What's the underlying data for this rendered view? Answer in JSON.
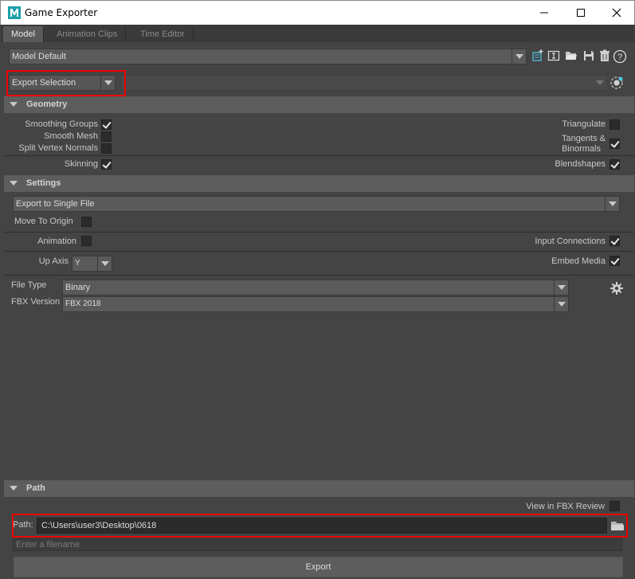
{
  "window": {
    "title": "Game Exporter"
  },
  "tabs": [
    {
      "label": "Model"
    },
    {
      "label": "Animation Clips"
    },
    {
      "label": "Time Editor"
    }
  ],
  "preset": {
    "value": "Model Default"
  },
  "export_mode": {
    "value": "Export Selection"
  },
  "geometry": {
    "header": "Geometry",
    "smoothing_groups": {
      "label": "Smoothing Groups",
      "checked": true
    },
    "smooth_mesh": {
      "label": "Smooth Mesh",
      "checked": false
    },
    "split_vertex_normals": {
      "label": "Split Vertex Normals",
      "checked": false
    },
    "skinning": {
      "label": "Skinning",
      "checked": true
    },
    "triangulate": {
      "label": "Triangulate",
      "checked": false
    },
    "tangents_binormals": {
      "label_line1": "Tangents &",
      "label_line2": "Binormals",
      "checked": true
    },
    "blendshapes": {
      "label": "Blendshapes",
      "checked": true
    }
  },
  "settings": {
    "header": "Settings",
    "file_mode": {
      "value": "Export to Single File"
    },
    "move_to_origin": {
      "label": "Move To Origin",
      "checked": false
    },
    "animation": {
      "label": "Animation",
      "checked": false
    },
    "input_connections": {
      "label": "Input Connections",
      "checked": true
    },
    "up_axis": {
      "label": "Up Axis",
      "value": "Y"
    },
    "embed_media": {
      "label": "Embed Media",
      "checked": true
    },
    "file_type": {
      "label": "File Type",
      "value": "Binary"
    },
    "fbx_version": {
      "label": "FBX Version",
      "value": "FBX 2018"
    }
  },
  "path_section": {
    "header": "Path",
    "view_in_fbx_review": {
      "label": "View in FBX Review",
      "checked": false
    },
    "path": {
      "label": "Path:",
      "value": "C:\\Users\\user3\\Desktop\\0618"
    },
    "filename": {
      "placeholder": "Enter a filename"
    }
  },
  "export_button": {
    "label": "Export"
  },
  "colors": {
    "highlight": "#e00000",
    "panel": "#444444",
    "header": "#5d5d5d"
  }
}
